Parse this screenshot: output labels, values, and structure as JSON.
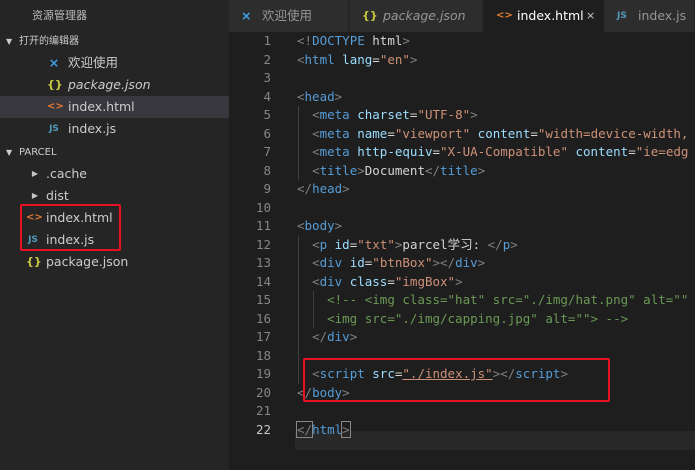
{
  "sidebar": {
    "title": "资源管理器",
    "open_editors": {
      "header": "打开的编辑器",
      "items": [
        {
          "label": "欢迎使用",
          "icon": "vscode-icon",
          "italic": false
        },
        {
          "label": "package.json",
          "icon": "json-icon",
          "italic": true
        },
        {
          "label": "index.html",
          "icon": "html-icon",
          "italic": false,
          "selected": true
        },
        {
          "label": "index.js",
          "icon": "js-icon",
          "italic": false
        }
      ]
    },
    "project": {
      "header": "PARCEL",
      "items": [
        {
          "label": ".cache",
          "icon": "folder-collapsed-icon"
        },
        {
          "label": "dist",
          "icon": "folder-collapsed-icon"
        },
        {
          "label": "index.html",
          "icon": "html-icon"
        },
        {
          "label": "index.js",
          "icon": "js-icon"
        },
        {
          "label": "package.json",
          "icon": "json-icon"
        }
      ]
    }
  },
  "tabs": [
    {
      "label": "欢迎使用",
      "icon": "vscode-icon",
      "italic": false,
      "active": false
    },
    {
      "label": "package.json",
      "icon": "json-icon",
      "italic": true,
      "active": false
    },
    {
      "label": "index.html",
      "icon": "html-icon",
      "italic": false,
      "active": true,
      "close": "×"
    },
    {
      "label": "index.js",
      "icon": "js-icon",
      "italic": false,
      "active": false
    }
  ],
  "icons": {
    "html": "<>",
    "js": "JS",
    "json": "{}",
    "vscode": "⨯",
    "arrow_down": "▼",
    "arrow_right": "▶"
  },
  "colors": {
    "highlight_box": "#e81123",
    "tag": "#569cd6",
    "attribute": "#9cdcfe",
    "string": "#ce9178",
    "comment": "#6a9955"
  },
  "editor": {
    "line_numbers": [
      "1",
      "2",
      "3",
      "4",
      "5",
      "6",
      "7",
      "8",
      "9",
      "10",
      "11",
      "12",
      "13",
      "14",
      "15",
      "16",
      "17",
      "18",
      "19",
      "20",
      "21",
      "22"
    ],
    "lines": [
      {
        "segs": [
          [
            "p",
            "<!"
          ],
          [
            "k",
            "DOCTYPE"
          ],
          [
            "x",
            " html"
          ],
          [
            "p",
            ">"
          ]
        ]
      },
      {
        "segs": [
          [
            "p",
            "<"
          ],
          [
            "t",
            "html"
          ],
          [
            "x",
            " "
          ],
          [
            "a",
            "lang"
          ],
          [
            "x",
            "="
          ],
          [
            "s",
            "\"en\""
          ],
          [
            "p",
            ">"
          ]
        ]
      },
      {
        "segs": []
      },
      {
        "segs": [
          [
            "p",
            "<"
          ],
          [
            "t",
            "head"
          ],
          [
            "p",
            ">"
          ]
        ]
      },
      {
        "segs": [
          [
            "x",
            "  "
          ],
          [
            "p",
            "<"
          ],
          [
            "t",
            "meta"
          ],
          [
            "x",
            " "
          ],
          [
            "a",
            "charset"
          ],
          [
            "x",
            "="
          ],
          [
            "s",
            "\"UTF-8\""
          ],
          [
            "p",
            ">"
          ]
        ]
      },
      {
        "segs": [
          [
            "x",
            "  "
          ],
          [
            "p",
            "<"
          ],
          [
            "t",
            "meta"
          ],
          [
            "x",
            " "
          ],
          [
            "a",
            "name"
          ],
          [
            "x",
            "="
          ],
          [
            "s",
            "\"viewport\""
          ],
          [
            "x",
            " "
          ],
          [
            "a",
            "content"
          ],
          [
            "x",
            "="
          ],
          [
            "s",
            "\"width=device-width,"
          ]
        ]
      },
      {
        "segs": [
          [
            "x",
            "  "
          ],
          [
            "p",
            "<"
          ],
          [
            "t",
            "meta"
          ],
          [
            "x",
            " "
          ],
          [
            "a",
            "http-equiv"
          ],
          [
            "x",
            "="
          ],
          [
            "s",
            "\"X-UA-Compatible\""
          ],
          [
            "x",
            " "
          ],
          [
            "a",
            "content"
          ],
          [
            "x",
            "="
          ],
          [
            "s",
            "\"ie=edg"
          ]
        ]
      },
      {
        "segs": [
          [
            "x",
            "  "
          ],
          [
            "p",
            "<"
          ],
          [
            "t",
            "title"
          ],
          [
            "p",
            ">"
          ],
          [
            "x",
            "Document"
          ],
          [
            "p",
            "</"
          ],
          [
            "t",
            "title"
          ],
          [
            "p",
            ">"
          ]
        ]
      },
      {
        "segs": [
          [
            "p",
            "</"
          ],
          [
            "t",
            "head"
          ],
          [
            "p",
            ">"
          ]
        ]
      },
      {
        "segs": []
      },
      {
        "segs": [
          [
            "p",
            "<"
          ],
          [
            "t",
            "body"
          ],
          [
            "p",
            ">"
          ]
        ]
      },
      {
        "segs": [
          [
            "x",
            "  "
          ],
          [
            "p",
            "<"
          ],
          [
            "t",
            "p"
          ],
          [
            "x",
            " "
          ],
          [
            "a",
            "id"
          ],
          [
            "x",
            "="
          ],
          [
            "s",
            "\"txt\""
          ],
          [
            "p",
            ">"
          ],
          [
            "x",
            "parcel学习: "
          ],
          [
            "p",
            "</"
          ],
          [
            "t",
            "p"
          ],
          [
            "p",
            ">"
          ]
        ]
      },
      {
        "segs": [
          [
            "x",
            "  "
          ],
          [
            "p",
            "<"
          ],
          [
            "t",
            "div"
          ],
          [
            "x",
            " "
          ],
          [
            "a",
            "id"
          ],
          [
            "x",
            "="
          ],
          [
            "s",
            "\"btnBox\""
          ],
          [
            "p",
            "></"
          ],
          [
            "t",
            "div"
          ],
          [
            "p",
            ">"
          ]
        ]
      },
      {
        "segs": [
          [
            "x",
            "  "
          ],
          [
            "p",
            "<"
          ],
          [
            "t",
            "div"
          ],
          [
            "x",
            " "
          ],
          [
            "a",
            "class"
          ],
          [
            "x",
            "="
          ],
          [
            "s",
            "\"imgBox\""
          ],
          [
            "p",
            ">"
          ]
        ]
      },
      {
        "segs": [
          [
            "x",
            "    "
          ],
          [
            "c",
            "<!-- <img class=\"hat\" src=\"./img/hat.png\" alt=\"\""
          ]
        ]
      },
      {
        "segs": [
          [
            "x",
            "    "
          ],
          [
            "c",
            "<img src=\"./img/capping.jpg\" alt=\"\"> -->"
          ]
        ]
      },
      {
        "segs": [
          [
            "x",
            "  "
          ],
          [
            "p",
            "</"
          ],
          [
            "t",
            "div"
          ],
          [
            "p",
            ">"
          ]
        ]
      },
      {
        "segs": []
      },
      {
        "segs": [
          [
            "x",
            "  "
          ],
          [
            "p",
            "<"
          ],
          [
            "t",
            "script"
          ],
          [
            "x",
            " "
          ],
          [
            "a",
            "src"
          ],
          [
            "x",
            "="
          ],
          [
            "su",
            "\"./index.js\""
          ],
          [
            "p",
            "></"
          ],
          [
            "t",
            "script"
          ],
          [
            "p",
            ">"
          ]
        ]
      },
      {
        "segs": [
          [
            "p",
            "</"
          ],
          [
            "t",
            "body"
          ],
          [
            "p",
            ">"
          ]
        ]
      },
      {
        "segs": []
      },
      {
        "segs": [
          [
            "pb",
            "</"
          ],
          [
            "t",
            "html"
          ],
          [
            "pb",
            ">"
          ]
        ]
      }
    ]
  }
}
